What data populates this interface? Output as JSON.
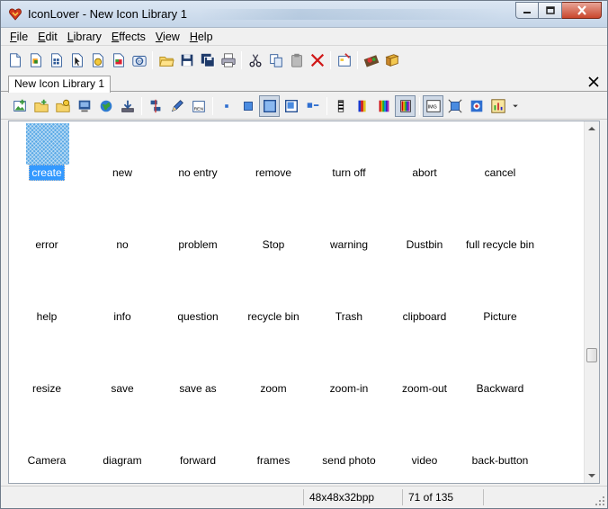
{
  "window": {
    "title": "IconLover - New Icon Library 1",
    "accent": "#3399ff"
  },
  "menu": [
    {
      "label": "File",
      "name": "menu-file"
    },
    {
      "label": "Edit",
      "name": "menu-edit"
    },
    {
      "label": "Library",
      "name": "menu-library"
    },
    {
      "label": "Effects",
      "name": "menu-effects"
    },
    {
      "label": "View",
      "name": "menu-view"
    },
    {
      "label": "Help",
      "name": "menu-help"
    }
  ],
  "toolbar": {
    "groups": [
      [
        "new-file-icon",
        "new-icon-file-icon",
        "new-library-icon",
        "new-cursor-icon",
        "new-animated-cursor-icon",
        "new-image-icon",
        "new-image-list-icon"
      ],
      [
        "open-folder-icon",
        "save-icon",
        "save-all-icon",
        "print-icon"
      ],
      [
        "cut-icon",
        "copy-icon",
        "paste-icon",
        "delete-icon"
      ],
      [
        "properties-icon"
      ],
      [
        "film-strip-icon",
        "book-icon"
      ]
    ]
  },
  "document_tab": {
    "label": "New Icon Library 1"
  },
  "library_toolbar": {
    "buttons": [
      "add-image-icon",
      "add-folder-icon",
      "add-files-icon",
      "extract-from-exe-icon",
      "web-icon",
      "download-icon",
      "|",
      "align-icon",
      "edit-pen-icon",
      "rename-icon",
      "|",
      "size-small-icon",
      "size-medium-icon",
      "size-large-icon",
      "size-xlarge-icon",
      "list-view-icon",
      "|",
      "color-mono-icon",
      "color-16-icon",
      "color-256-icon",
      "color-true-icon",
      "|",
      "image-format-icon",
      "resize-icon",
      "preview-icon",
      "chart-menu-icon",
      "dropdown-icon"
    ],
    "pressed": [
      "size-large-icon",
      "color-true-icon",
      "image-format-icon"
    ]
  },
  "library": {
    "selected_index": 0,
    "icons": [
      "create",
      "new",
      "no entry",
      "remove",
      "turn off",
      "abort",
      "cancel",
      "error",
      "no",
      "problem",
      "Stop",
      "warning",
      "Dustbin",
      "full recycle bin",
      "help",
      "info",
      "question",
      "recycle bin",
      "Trash",
      "clipboard",
      "Picture",
      "resize",
      "save",
      "save as",
      "zoom",
      "zoom-in",
      "zoom-out",
      "Backward",
      "Camera",
      "diagram",
      "forward",
      "frames",
      "send photo",
      "video",
      "back-button"
    ],
    "columns": 7
  },
  "status": {
    "format": "48x48x32bpp",
    "position": "71 of 135"
  }
}
